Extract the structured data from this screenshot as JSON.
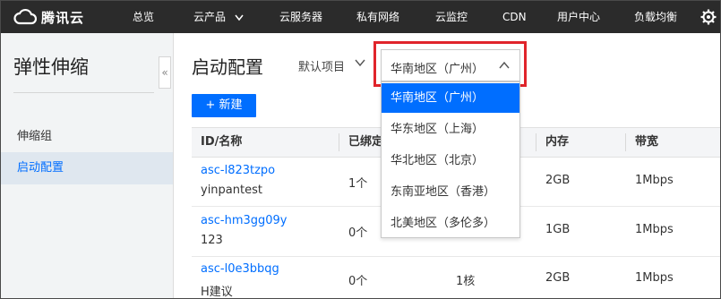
{
  "app": {
    "logo_text": "腾讯云"
  },
  "topnav": {
    "items": [
      "总览",
      "云产品",
      "云服务器",
      "私有网络",
      "云监控",
      "CDN",
      "用户中心",
      "负载均衡"
    ]
  },
  "sidebar": {
    "title": "弹性伸缩",
    "items": [
      {
        "label": "伸缩组",
        "active": false
      },
      {
        "label": "启动配置",
        "active": true
      }
    ]
  },
  "main": {
    "title": "启动配置",
    "project_select": "默认项目",
    "region_select": "华南地区（广州）",
    "new_button": "+ 新建"
  },
  "region_dropdown": {
    "options": [
      {
        "label": "华南地区（广州）",
        "selected": true
      },
      {
        "label": "华东地区（上海）",
        "selected": false
      },
      {
        "label": "华北地区（北京）",
        "selected": false
      },
      {
        "label": "东南亚地区（香港）",
        "selected": false
      },
      {
        "label": "北美地区（多伦多）",
        "selected": false
      }
    ]
  },
  "table": {
    "headers": {
      "id_name": "ID/名称",
      "bound": "已绑定",
      "memory": "内存",
      "bandwidth": "带宽"
    },
    "rows": [
      {
        "id": "asc-l823tzpo",
        "name": "yinpantest",
        "bound": "1个",
        "cpu": "",
        "memory": "2GB",
        "bandwidth": "1Mbps"
      },
      {
        "id": "asc-hm3gg09y",
        "name": "123",
        "bound": "0个",
        "cpu": "",
        "memory": "1GB",
        "bandwidth": "1Mbps"
      },
      {
        "id": "asc-l0e3bbqg",
        "name": "H建议",
        "bound": "0个",
        "cpu": "1核",
        "memory": "2GB",
        "bandwidth": "1Mbps"
      }
    ]
  },
  "colors": {
    "accent": "#006eff",
    "highlight": "#e0242b",
    "nav_bg": "#2b2b2b"
  }
}
